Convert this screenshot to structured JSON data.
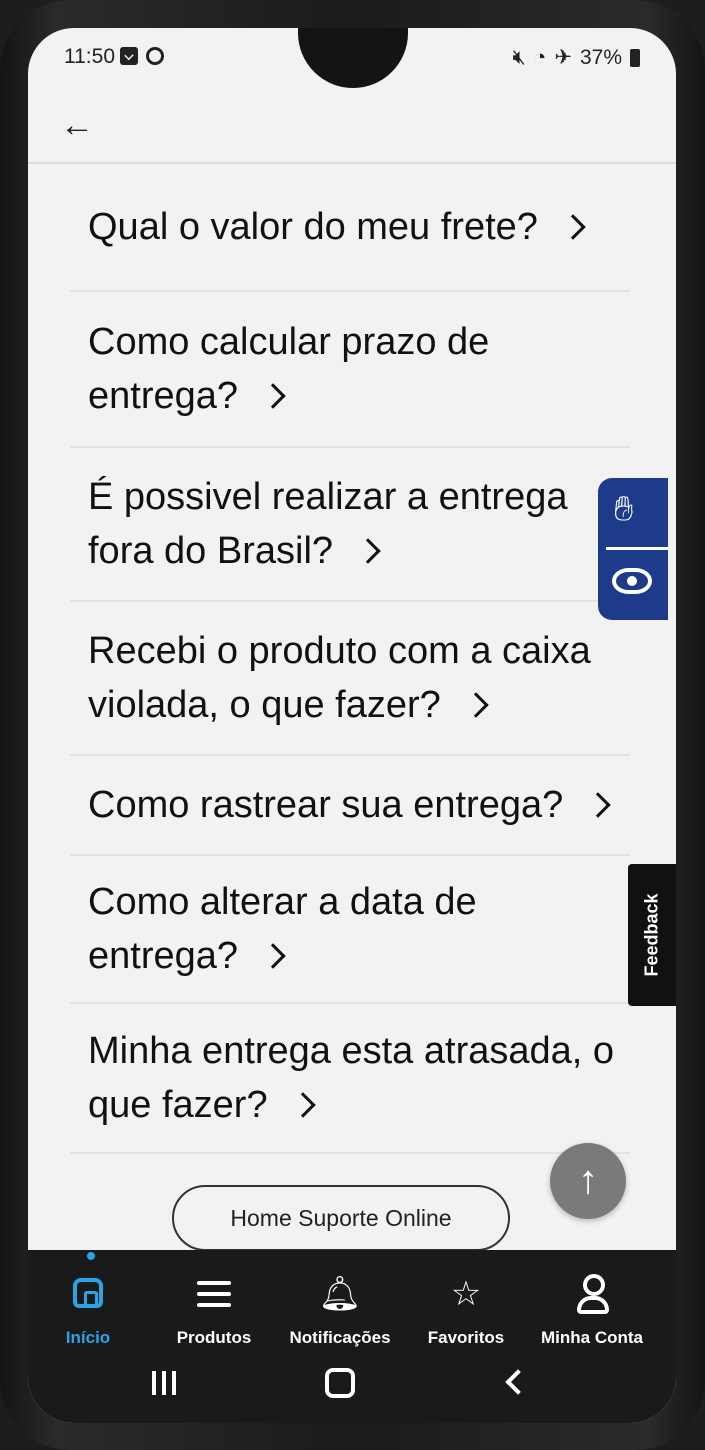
{
  "status_bar": {
    "time": "11:50",
    "battery": "37%",
    "icons": [
      "message-icon",
      "circle-icon",
      "mute-icon",
      "wifi-icon",
      "airplane-icon",
      "battery-icon"
    ]
  },
  "topbar": {
    "back_icon": "arrow-left-icon"
  },
  "faq": [
    {
      "lines": [
        "Qual o valor do meu frete?"
      ]
    },
    {
      "lines": [
        "Como calcular prazo de",
        "entrega?"
      ]
    },
    {
      "lines": [
        "É possivel realizar a entrega",
        "fora do Brasil?"
      ]
    },
    {
      "lines": [
        "Recebi o produto com a caixa",
        "violada, o que fazer?"
      ]
    },
    {
      "lines": [
        "Como rastrear sua entrega?"
      ]
    },
    {
      "lines": [
        "Como alterar a data de",
        "entrega?"
      ]
    },
    {
      "lines": [
        "Minha entrega esta atrasada, o",
        "que fazer?"
      ]
    }
  ],
  "accessibility": {
    "icons": [
      "sign-language-icon",
      "eye-icon"
    ],
    "color": "#1e3a8a"
  },
  "feedback_tab": {
    "label": "Feedback"
  },
  "scroll_top": {
    "icon": "arrow-up-icon"
  },
  "home_support_button": {
    "label": "Home Suporte Online"
  },
  "bottom_nav": {
    "accent": "#2aa3e8",
    "items": [
      {
        "label": "Início",
        "icon": "home-icon",
        "active": true
      },
      {
        "label": "Produtos",
        "icon": "menu-icon",
        "active": false
      },
      {
        "label": "Notificações",
        "icon": "bell-icon",
        "active": false
      },
      {
        "label": "Favoritos",
        "icon": "star-icon",
        "active": false
      },
      {
        "label": "Minha Conta",
        "icon": "user-icon",
        "active": false
      }
    ]
  },
  "system_nav": {
    "icons": [
      "recents-icon",
      "home-circle-icon",
      "back-chevron-icon"
    ]
  }
}
